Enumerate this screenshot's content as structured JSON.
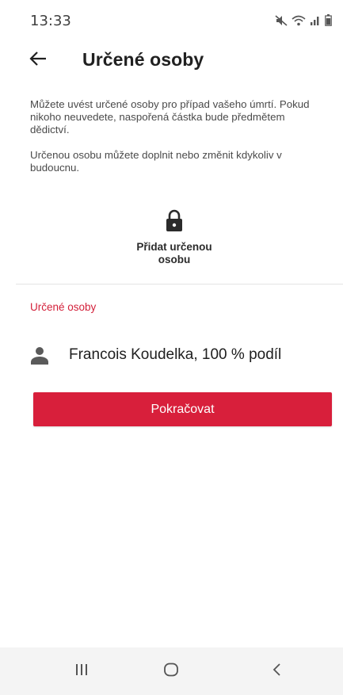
{
  "status_bar": {
    "time": "13:33",
    "icons": [
      "mute-icon",
      "wifi-icon",
      "signal-icon",
      "battery-icon"
    ]
  },
  "header": {
    "title": "Určené osoby",
    "back_icon": "arrow-left-icon"
  },
  "intro": {
    "paragraph_1": "Můžete uvést určené osoby pro případ vašeho úmrtí. Pokud nikoho neuvedete, naspořená částka bude předmětem dědictví.",
    "paragraph_2": "Určenou osobu můžete doplnit nebo změnit kdykoliv v budoucnu."
  },
  "add_person": {
    "icon": "lock-icon",
    "label_line_1": "Přidat určenou",
    "label_line_2": "osobu"
  },
  "section": {
    "title": "Určené osoby"
  },
  "persons": [
    {
      "icon": "person-icon",
      "name": "Francois Koudelka, 100 % podíl"
    }
  ],
  "actions": {
    "continue_label": "Pokračovat"
  },
  "nav_bar": {
    "buttons": [
      "recent-apps-icon",
      "home-icon",
      "back-nav-icon"
    ]
  },
  "colors": {
    "accent": "#d81f3b",
    "section_title": "#d3203a",
    "text_primary": "#202020",
    "text_secondary": "#4a4a4a",
    "nav_bar_bg": "#f4f4f4"
  }
}
